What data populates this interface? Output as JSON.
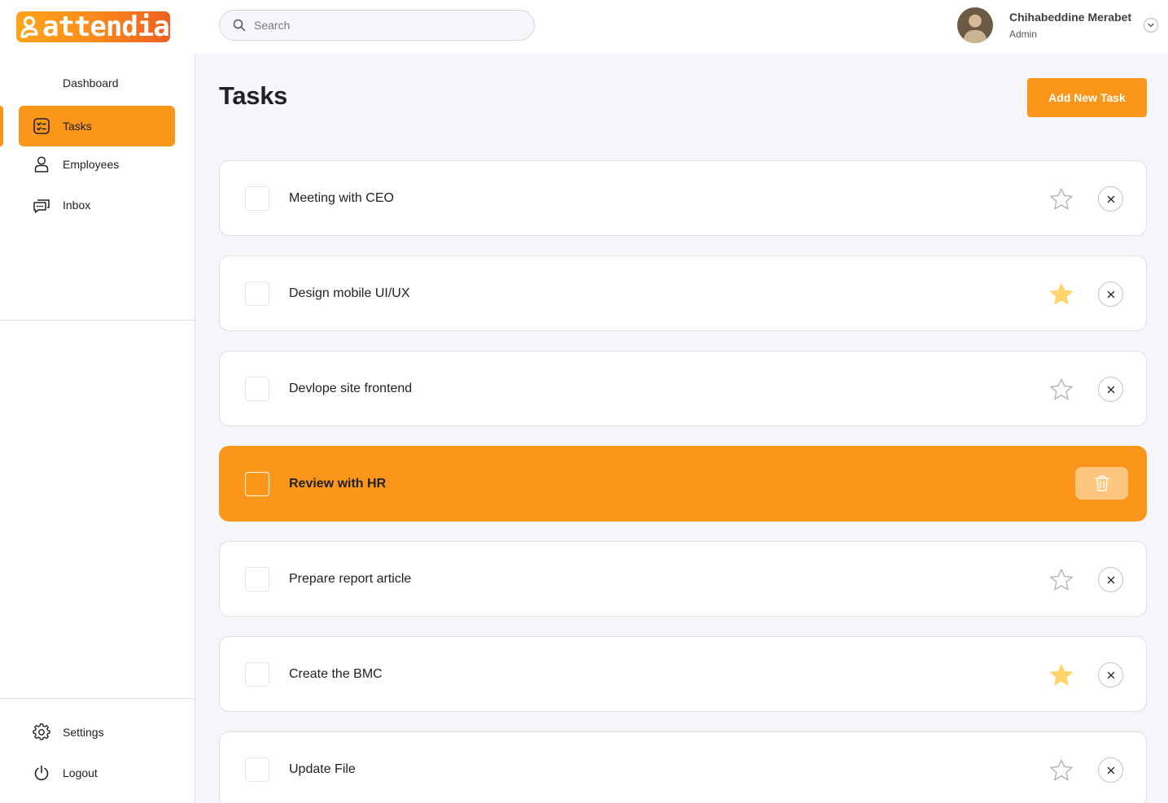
{
  "brand": {
    "name": "attendia",
    "gradient_from": "#ffa31a",
    "gradient_to": "#ef5f20"
  },
  "search": {
    "placeholder": "Search",
    "value": ""
  },
  "user": {
    "name": "Chihabeddine Merabet",
    "role": "Admin"
  },
  "sidebar": {
    "items": [
      {
        "label": "Dashboard",
        "icon": "dashboard-icon",
        "active": false
      },
      {
        "label": "Tasks",
        "icon": "tasks-icon",
        "active": true
      },
      {
        "label": "Employees",
        "icon": "user-icon",
        "active": false
      },
      {
        "label": "Inbox",
        "icon": "inbox-icon",
        "active": false
      }
    ],
    "bottom_items": [
      {
        "label": "Settings",
        "icon": "gear-icon"
      },
      {
        "label": "Logout",
        "icon": "power-icon"
      }
    ]
  },
  "page": {
    "title": "Tasks",
    "add_button_label": "Add New Task"
  },
  "tasks": [
    {
      "title": "Meeting with CEO",
      "starred": false,
      "highlighted": false
    },
    {
      "title": "Design mobile UI/UX",
      "starred": true,
      "highlighted": false
    },
    {
      "title": "Devlope site frontend",
      "starred": false,
      "highlighted": false
    },
    {
      "title": "Review with HR",
      "starred": false,
      "highlighted": true
    },
    {
      "title": "Prepare report article",
      "starred": false,
      "highlighted": false
    },
    {
      "title": "Create the BMC",
      "starred": true,
      "highlighted": false
    },
    {
      "title": "Update File",
      "starred": false,
      "highlighted": false
    }
  ],
  "colors": {
    "accent": "#fb961a",
    "star_filled": "#ffd56d",
    "star_empty": "#b3b3b3",
    "page_background": "#f5f6fa"
  }
}
